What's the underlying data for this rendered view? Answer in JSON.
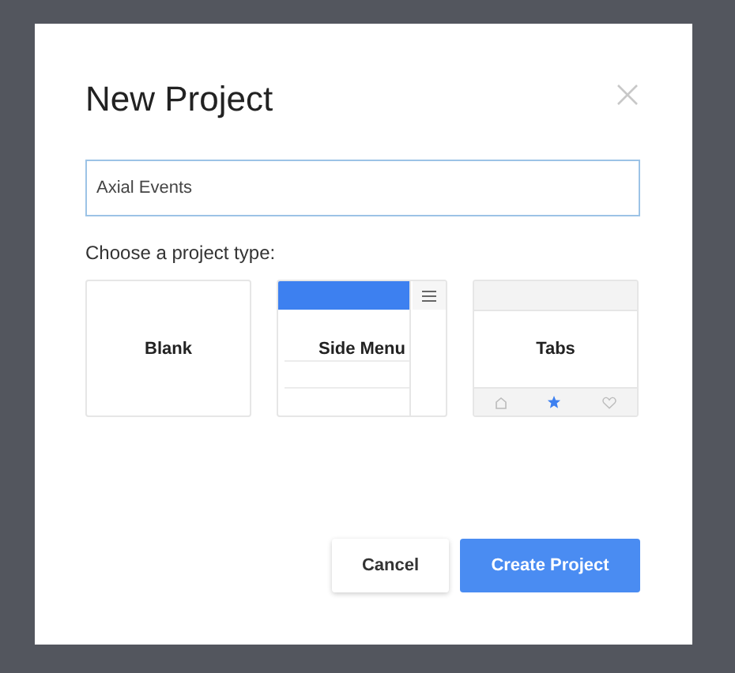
{
  "dialog": {
    "title": "New Project",
    "name_field": {
      "value": "Axial Events"
    },
    "type_label": "Choose a project type:",
    "project_types": [
      {
        "kind": "blank",
        "label": "Blank"
      },
      {
        "kind": "sidemenu",
        "label": "Side Menu"
      },
      {
        "kind": "tabs",
        "label": "Tabs"
      }
    ],
    "buttons": [
      {
        "kind": "secondary",
        "label": "Cancel"
      },
      {
        "kind": "primary",
        "label": "Create Project"
      }
    ]
  }
}
